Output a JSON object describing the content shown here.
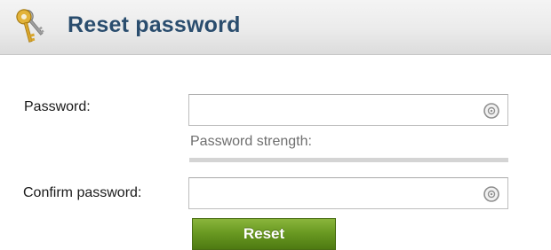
{
  "header": {
    "title": "Reset password",
    "icon": "keys-icon"
  },
  "form": {
    "password_label": "Password:",
    "password_value": "",
    "password_icon": "reveal-icon",
    "strength_label": "Password strength:",
    "strength_level": 0,
    "confirm_label": "Confirm password:",
    "confirm_value": "",
    "confirm_icon": "reveal-icon",
    "reset_label": "Reset"
  },
  "colors": {
    "title": "#2a4d6e",
    "button": "#6a9a22",
    "strength_track": "#d4d4d4"
  }
}
